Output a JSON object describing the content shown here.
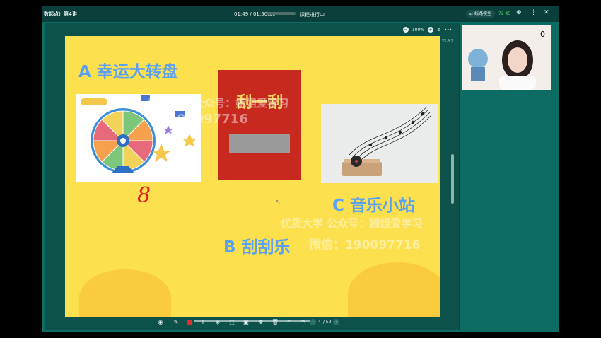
{
  "topbar": {
    "title": "数起点）第4讲",
    "time": "01:49 / 01:50:00",
    "status": "课程进行中",
    "lines_label": "线路模型",
    "signal": "72 45"
  },
  "whiteboard": {
    "zoom": "100%",
    "version": "V2.4.7"
  },
  "slide": {
    "option_a": "A 幸运大转盘",
    "option_b": "B 刮刮乐",
    "option_c": "C 音乐小站",
    "scratch_title": "刮一刮",
    "handwritten_number": "8",
    "watermark_1": "优质大学 公众号：婉姐爱学习",
    "watermark_1_num": "190097716",
    "watermark_2": "优质大学 公众号：婉姐爱学习",
    "watermark_2_num": "微信：190097716"
  },
  "pager": {
    "current": "4",
    "total": "/ 59"
  },
  "video": {
    "counter": "0"
  },
  "colors": {
    "app_bg": "#0c6b63",
    "slide_bg": "#fce04d",
    "heading": "#5ba1f1",
    "scratch_card": "#c8291f",
    "ink_red": "#e02020"
  }
}
